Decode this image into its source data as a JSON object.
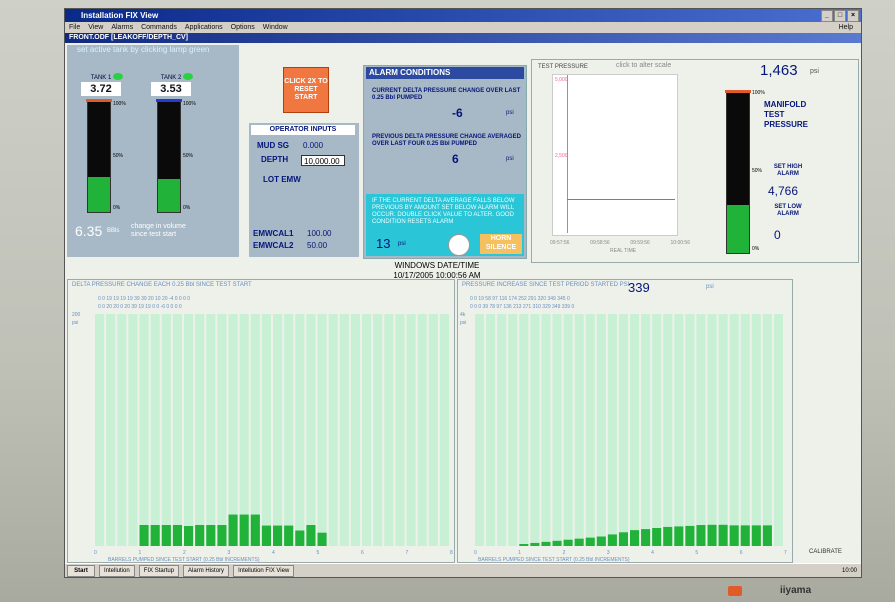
{
  "window": {
    "title": "Installation FIX View",
    "menu": [
      "File",
      "View",
      "Alarms",
      "Commands",
      "Applications",
      "Options",
      "Window"
    ],
    "help": "Help",
    "subtitle": "FRONT.ODF   [LEAKOFF/DEPTH_CV]"
  },
  "tanks": {
    "note": "set active tank by clicking lamp green",
    "tank1": {
      "name": "TANK 1",
      "value": "3.72",
      "level": 0.32
    },
    "tank2": {
      "name": "TANK 2",
      "value": "3.53",
      "level": 0.3
    },
    "ticks": [
      "100%",
      "50%",
      "0%"
    ],
    "volume_change": "6.35",
    "volume_unit": "BBls",
    "volume_label": "change in volume since test start"
  },
  "reset": {
    "label": "CLICK 2X TO RESET START"
  },
  "operator": {
    "title": "OPERATOR INPUTS",
    "mud_sg_label": "MUD SG",
    "mud_sg": "0.000",
    "depth_label": "DEPTH",
    "depth": "10,000.00",
    "lot_label": "LOT EMW",
    "emwcal1_label": "EMWCAL1",
    "emwcal1": "100.00",
    "emwcal2_label": "EMWCAL2",
    "emwcal2": "50.00"
  },
  "alarm": {
    "title": "ALARM CONDITIONS",
    "current_label": "CURRENT DELTA PRESSURE CHANGE OVER LAST 0.25 Bbl PUMPED",
    "current_value": "-6",
    "previous_label": "PREVIOUS DELTA PRESSURE CHANGE AVERAGED OVER LAST FOUR 0.25 Bbl PUMPED",
    "previous_value": "6",
    "unit": "psi",
    "note": "IF THE CURRENT DELTA AVERAGE FALLS BELOW PREVIOUS BY AMOUNT SET BELOW ALARM WILL OCCUR. DOUBLE CLICK VALUE TO ALTER. GOOD CONDITION RESETS ALARM",
    "threshold": "13",
    "horn_label": "HORN SILENCE"
  },
  "datetime": {
    "label": "WINDOWS DATE/TIME",
    "value": "10/17/2005 10:00:56 AM"
  },
  "test_pressure": {
    "title": "TEST PRESSURE",
    "scale_hint": "click to alter scale",
    "y_top": "5,000",
    "y_mid": "2,500",
    "x_labels": [
      "09:57:56",
      "09:58:56",
      "09:59:56",
      "10:00:56"
    ],
    "x_title": "REAL TIME"
  },
  "manifold": {
    "value": "1,463",
    "unit": "psi",
    "label": "MANIFOLD TEST PRESSURE",
    "level": 0.3,
    "ticks": [
      "100%",
      "50%",
      "0%"
    ],
    "high_label": "SET HIGH ALARM",
    "high_value": "4,766",
    "low_label": "SET LOW ALARM",
    "low_value": "0"
  },
  "delta_chart": {
    "title": "DELTA PRESSURE CHANGE EACH 0.25 Bbl SINCE TEST START",
    "row1": "0  0  19  19  19  19  39  39  20  10  20  -4  0  0  0  0",
    "row2": "0  0  20  20  0  20  39  19  19  0  0  -6  0  0  0  0",
    "unit_top": "200",
    "unit": "psi",
    "footer": "BARRELS PUMPED SINCE TEST START (0.25 Bbl INCREMENTS)",
    "x_ticks": [
      "0",
      "1",
      "2",
      "3",
      "4",
      "5",
      "6",
      "7",
      "8"
    ],
    "bar_count": 32,
    "values": [
      0,
      0,
      0,
      0,
      0,
      0,
      0,
      0,
      0,
      0,
      0,
      0,
      0,
      0,
      0,
      0,
      0,
      0,
      0,
      0,
      0,
      0,
      0,
      0,
      0,
      0,
      0,
      0,
      0,
      0,
      0,
      0
    ],
    "heights": [
      0,
      0,
      0,
      0,
      0,
      0,
      0,
      0,
      0,
      0,
      0,
      0,
      0,
      0,
      0,
      0,
      0,
      0,
      0,
      0,
      0,
      0,
      0,
      0,
      0,
      0,
      0,
      0,
      0,
      0,
      0,
      0
    ]
  },
  "increase_chart": {
    "title": "PRESSURE INCREASE SINCE TEST PERIOD STARTED  PSI",
    "value": "339",
    "unit_small": "psi",
    "row1": "0  0  19  58  97  116  174  252  291  320  349  345  0",
    "row2": "0  0  0  39  78  97  136  213  271  310  329  349  339  0",
    "unit_top": "4k",
    "unit": "psi",
    "footer": "BARRELS PUMPED SINCE TEST START (0.25 Bbl INCREMENTS)",
    "x_ticks": [
      "0",
      "1",
      "2",
      "3",
      "4",
      "5",
      "6",
      "7"
    ],
    "calibrate": "CALIBRATE"
  },
  "chart_data": [
    {
      "type": "bar",
      "title": "DELTA PRESSURE CHANGE EACH 0.25 Bbl SINCE TEST START",
      "xlabel": "BARRELS PUMPED SINCE TEST START (0.25 Bbl INCREMENTS)",
      "ylabel": "psi",
      "ylim": [
        -200,
        200
      ],
      "x": [
        1.0,
        1.25,
        1.5,
        1.75,
        2.0,
        2.25,
        2.5,
        2.75,
        3.0,
        3.25,
        3.5,
        3.75,
        4.0,
        4.25,
        4.5,
        4.75,
        5.0
      ],
      "values": [
        20,
        20,
        20,
        20,
        0,
        20,
        20,
        20,
        39,
        39,
        39,
        19,
        19,
        19,
        10,
        20,
        -6
      ]
    },
    {
      "type": "bar",
      "title": "PRESSURE INCREASE SINCE TEST PERIOD STARTED PSI",
      "xlabel": "BARRELS PUMPED SINCE TEST START (0.25 Bbl INCREMENTS)",
      "ylabel": "psi",
      "ylim": [
        0,
        4000
      ],
      "x": [
        1.0,
        1.25,
        1.5,
        1.75,
        2.0,
        2.25,
        2.5,
        2.75,
        3.0,
        3.25,
        3.5,
        3.75,
        4.0,
        4.25,
        4.5,
        4.75,
        5.0,
        5.25,
        5.5,
        5.75,
        6.0,
        6.25,
        6.5
      ],
      "values": [
        0,
        19,
        39,
        58,
        78,
        97,
        116,
        136,
        174,
        213,
        252,
        271,
        291,
        310,
        320,
        329,
        345,
        349,
        349,
        339,
        339,
        339,
        339
      ]
    }
  ],
  "taskbar": {
    "start": "Start",
    "items": [
      "Intellution",
      "FIX Startup",
      "Alarm History",
      "Intellution FIX View"
    ],
    "clock": "10:00"
  },
  "monitor": {
    "brand": "iiyama"
  }
}
